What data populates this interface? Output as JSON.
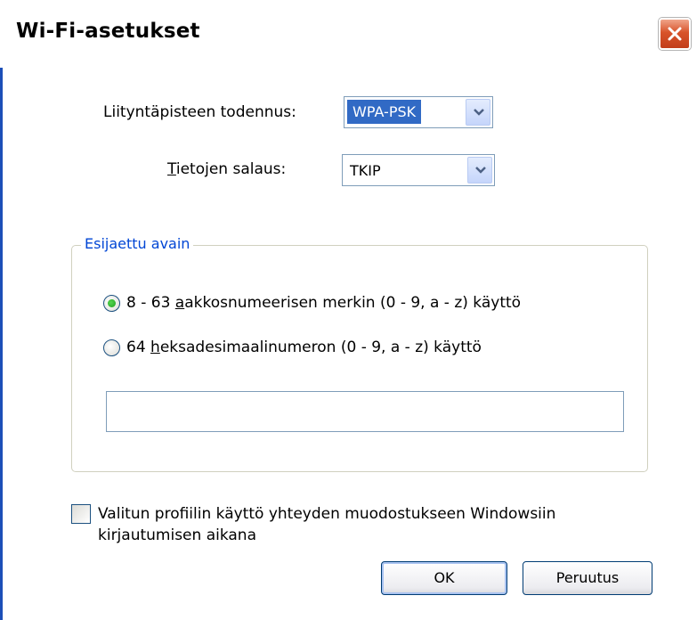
{
  "dialog": {
    "title": "Wi-Fi-asetukset"
  },
  "auth": {
    "label": "Liityntäpisteen todennus:",
    "value": "WPA-PSK"
  },
  "encryption": {
    "label_access_key": "T",
    "label_rest": "ietojen salaus:",
    "value": "TKIP"
  },
  "psk_group": {
    "title": "Esijaettu avain",
    "option1_prefix": "8 - 63 ",
    "option1_key": "a",
    "option1_rest": "akkosnumeerisen merkin (0 - 9, a - z) käyttö",
    "option1_selected": true,
    "option2_prefix": "64 ",
    "option2_key": "h",
    "option2_rest": "eksadesimaalinumeron (0 - 9, a - z) käyttö",
    "option2_selected": false,
    "key_value": ""
  },
  "logon_checkbox": {
    "line1": "Valitun profiilin käyttö yhteyden muodostukseen Windowsiin",
    "line2": "kirjautumisen aikana",
    "checked": false
  },
  "buttons": {
    "ok": "OK",
    "cancel": "Peruutus"
  },
  "colors": {
    "accent_group_title": "#0046d5",
    "selection": "#316ac5",
    "close_button": "#d8532a",
    "radio_selected": "#21a121"
  }
}
